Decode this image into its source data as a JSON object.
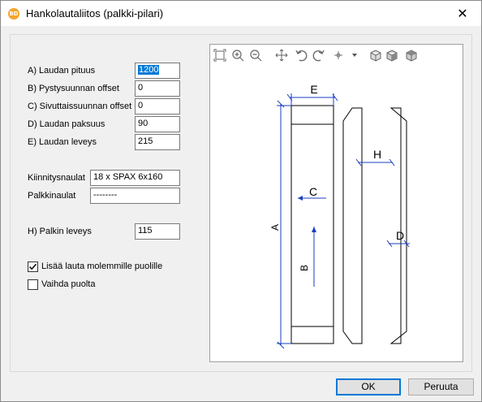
{
  "window": {
    "app_icon_text": "BD",
    "title": "Hankolautaliitos (palkki-pilari)",
    "close_glyph": "✕"
  },
  "form": {
    "fields": [
      {
        "label": "A) Laudan pituus",
        "value": "1200"
      },
      {
        "label": "B) Pystysuunnan offset",
        "value": "0"
      },
      {
        "label": "C) Sivuttaissuunnan offset",
        "value": "0"
      },
      {
        "label": "D) Laudan paksuus",
        "value": "90"
      },
      {
        "label": "E) Laudan leveys",
        "value": "215"
      }
    ],
    "nails": [
      {
        "label": "Kiinnitysnaulat",
        "value": "18 x SPAX 6x160"
      },
      {
        "label": "Palkkinaulat",
        "value": "--------"
      }
    ],
    "beam": {
      "label": "H) Palkin leveys",
      "value": "115"
    },
    "checkboxes": [
      {
        "label": "Lisää lauta molemmille puolille",
        "checked": true
      },
      {
        "label": "Vaihda puolta",
        "checked": false
      }
    ]
  },
  "preview": {
    "toolbar_icons": [
      "zoom-extents-icon",
      "zoom-in-icon",
      "zoom-out-icon",
      "pan-icon",
      "rotate-left-icon",
      "rotate-right-icon",
      "view-options-icon",
      "dropdown-arrow-icon",
      "view-cube-front-icon",
      "view-cube-side-icon",
      "view-cube-top-icon"
    ],
    "dim_labels": {
      "A": "A",
      "B": "B",
      "C": "C",
      "D": "D",
      "E": "E",
      "H": "H"
    },
    "dimension_color": "#1a3fbf"
  },
  "buttons": {
    "ok": "OK",
    "cancel": "Peruuta"
  }
}
